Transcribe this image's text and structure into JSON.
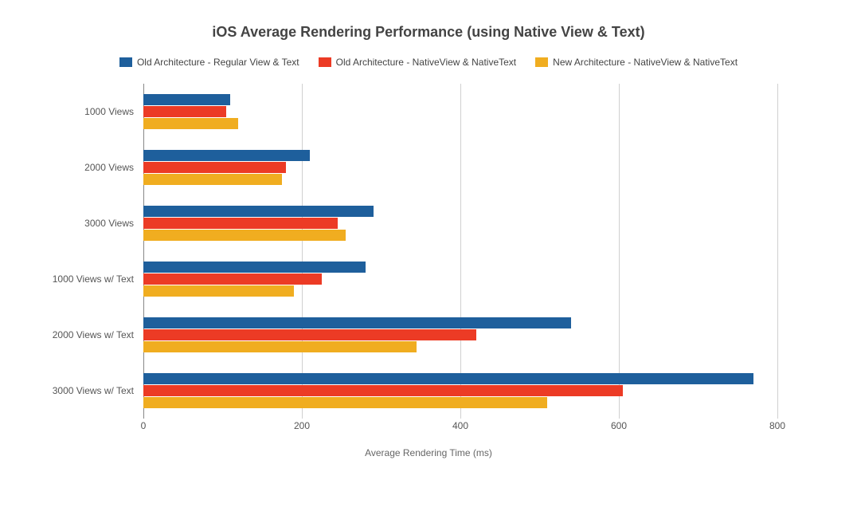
{
  "chart_data": {
    "type": "bar",
    "orientation": "horizontal",
    "title": "iOS Average Rendering Performance (using Native View & Text)",
    "xlabel": "Average Rendering Time (ms)",
    "ylabel": "",
    "xlim": [
      0,
      800
    ],
    "xticks": [
      0,
      200,
      400,
      600,
      800
    ],
    "categories": [
      "1000 Views",
      "2000 Views",
      "3000 Views",
      "1000 Views w/ Text",
      "2000 Views w/ Text",
      "3000 Views w/ Text"
    ],
    "series": [
      {
        "name": "Old Architecture - Regular View & Text",
        "color": "#1E5F9C",
        "values": [
          110,
          210,
          290,
          280,
          540,
          770
        ]
      },
      {
        "name": "Old Architecture - NativeView & NativeText",
        "color": "#EC3B25",
        "values": [
          105,
          180,
          245,
          225,
          420,
          605
        ]
      },
      {
        "name": "New Architecture - NativeView & NativeText",
        "color": "#F0AD20",
        "values": [
          120,
          175,
          255,
          190,
          345,
          510
        ]
      }
    ],
    "legend_position": "top",
    "grid": true
  }
}
